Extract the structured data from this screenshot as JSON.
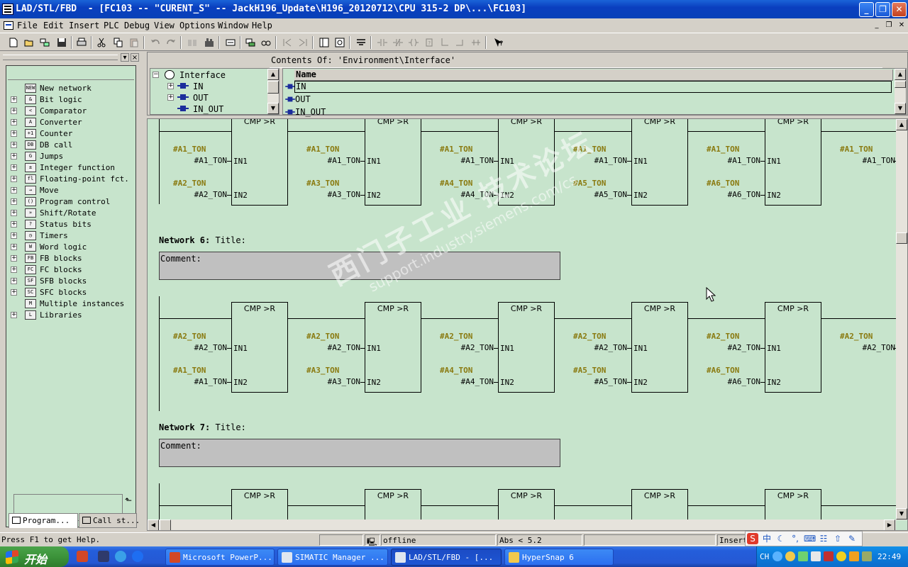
{
  "window": {
    "title": "LAD/STL/FBD  - [FC103 -- \"CURENT_S\" -- JackH196_Update\\H196_20120712\\CPU 315-2 DP\\...\\FC103]"
  },
  "menu": {
    "items": [
      "File",
      "Edit",
      "Insert",
      "PLC",
      "Debug",
      "View",
      "Options",
      "Window",
      "Help"
    ]
  },
  "toolbar": {
    "icons": [
      "new-icon",
      "open-icon",
      "accessible-nodes-icon",
      "save-icon",
      "print-icon",
      "cut-icon",
      "copy-icon",
      "paste-icon",
      "undo-icon",
      "redo-icon",
      "load-icon",
      "simatic-manager-icon",
      "overview-icon",
      "compile-icon",
      "online-icon",
      "network-jump-icon",
      "network-icon",
      "help-icon"
    ]
  },
  "catalog": {
    "items": [
      {
        "icon": "new-network-icon",
        "label": "New network",
        "expandable": false
      },
      {
        "icon": "bit-logic-icon",
        "label": "Bit logic",
        "expandable": true
      },
      {
        "icon": "comparator-icon",
        "label": "Comparator",
        "expandable": true
      },
      {
        "icon": "converter-icon",
        "label": "Converter",
        "expandable": true
      },
      {
        "icon": "counter-icon",
        "label": "Counter",
        "expandable": true
      },
      {
        "icon": "db-call-icon",
        "label": "DB call",
        "expandable": true
      },
      {
        "icon": "jumps-icon",
        "label": "Jumps",
        "expandable": true
      },
      {
        "icon": "integer-function-icon",
        "label": "Integer function",
        "expandable": true
      },
      {
        "icon": "floating-point-icon",
        "label": "Floating-point fct.",
        "expandable": true
      },
      {
        "icon": "move-icon",
        "label": "Move",
        "expandable": true
      },
      {
        "icon": "program-control-icon",
        "label": "Program control",
        "expandable": true
      },
      {
        "icon": "shift-rotate-icon",
        "label": "Shift/Rotate",
        "expandable": true
      },
      {
        "icon": "status-bits-icon",
        "label": "Status bits",
        "expandable": true
      },
      {
        "icon": "timers-icon",
        "label": "Timers",
        "expandable": true
      },
      {
        "icon": "word-logic-icon",
        "label": "Word logic",
        "expandable": true
      },
      {
        "icon": "fb-blocks-icon",
        "label": "FB blocks",
        "expandable": true
      },
      {
        "icon": "fc-blocks-icon",
        "label": "FC blocks",
        "expandable": true
      },
      {
        "icon": "sfb-blocks-icon",
        "label": "SFB blocks",
        "expandable": true
      },
      {
        "icon": "sfc-blocks-icon",
        "label": "SFC blocks",
        "expandable": true
      },
      {
        "icon": "multiple-instances-icon",
        "label": "Multiple instances",
        "expandable": false
      },
      {
        "icon": "libraries-icon",
        "label": "Libraries",
        "expandable": true
      }
    ],
    "icon_glyphs": [
      "NEW",
      "&",
      "<",
      "A",
      "+1",
      "DB",
      "G",
      "±",
      "fl",
      "→",
      "()",
      "»",
      "?",
      "◷",
      "W",
      "FB",
      "FC",
      "SF",
      "SC",
      "M",
      "L"
    ],
    "tabs": [
      "Program...",
      "Call st..."
    ]
  },
  "interface": {
    "contents_label": "Contents Of: 'Environment\\Interface'",
    "tree": {
      "root": "Interface",
      "children": [
        "IN",
        "OUT",
        "IN_OUT"
      ]
    },
    "table": {
      "column": "Name",
      "rows": [
        "IN",
        "OUT",
        "IN_OUT"
      ],
      "selected_row": "IN"
    }
  },
  "editor": {
    "networks": [
      {
        "label": "Network 6",
        "title": "Title:",
        "comment": "Comment:"
      },
      {
        "label": "Network 7",
        "title": "Title:",
        "comment": "Comment:"
      }
    ],
    "block_name": "CMP >R",
    "pin1": "IN1",
    "pin2": "IN2",
    "rung_top": {
      "in1_symbols": [
        "#A1_TON",
        "#A1_TON",
        "#A1_TON",
        "#A1_TON",
        "#A1_TON",
        "#A1_TON"
      ],
      "in1_operands": [
        "#A1_TON",
        "#A1_TON",
        "#A1_TON",
        "#A1_TON",
        "#A1_TON",
        "#A1_TON"
      ],
      "in2_symbols": [
        "#A2_TON",
        "#A3_TON",
        "#A4_TON",
        "#A5_TON",
        "#A6_TON"
      ],
      "in2_operands": [
        "#A2_TON",
        "#A3_TON",
        "#A4_TON",
        "#A5_TON",
        "#A6_TON"
      ]
    },
    "rung_network6": {
      "in1_symbols": [
        "#A2_TON",
        "#A2_TON",
        "#A2_TON",
        "#A2_TON",
        "#A2_TON",
        "#A2_TON"
      ],
      "in1_operands": [
        "#A2_TON",
        "#A2_TON",
        "#A2_TON",
        "#A2_TON",
        "#A2_TON",
        "#A2_TON"
      ],
      "in2_symbols": [
        "#A1_TON",
        "#A3_TON",
        "#A4_TON",
        "#A5_TON",
        "#A6_TON"
      ],
      "in2_operands": [
        "#A1_TON",
        "#A3_TON",
        "#A4_TON",
        "#A5_TON",
        "#A6_TON"
      ]
    },
    "watermark": {
      "line1": "西门子工业 技术论坛",
      "line2": "support.industry.siemens.com/cs"
    }
  },
  "statusbar": {
    "hint": "Press F1 to get Help.",
    "mode": "offline",
    "position": "Abs < 5.2",
    "insert": "Insert"
  },
  "taskbar": {
    "start_label": "开始",
    "buttons": [
      {
        "label": "Microsoft PowerP...",
        "active": false,
        "color": "#d24726"
      },
      {
        "label": "SIMATIC Manager ...",
        "active": false,
        "color": "#dfe6ef"
      },
      {
        "label": "LAD/STL/FBD  - [...",
        "active": true,
        "color": "#dfe6ef"
      },
      {
        "label": "HyperSnap 6",
        "active": false,
        "color": "#f2c94c"
      }
    ],
    "tray_lang": "CH",
    "clock": "22:49"
  },
  "colors": {
    "editor_bg": "#c7e4cc",
    "symbol_text": "#8a7a10",
    "comment_bg": "#c0c0c0",
    "titlebar": "#0a3fbf"
  }
}
